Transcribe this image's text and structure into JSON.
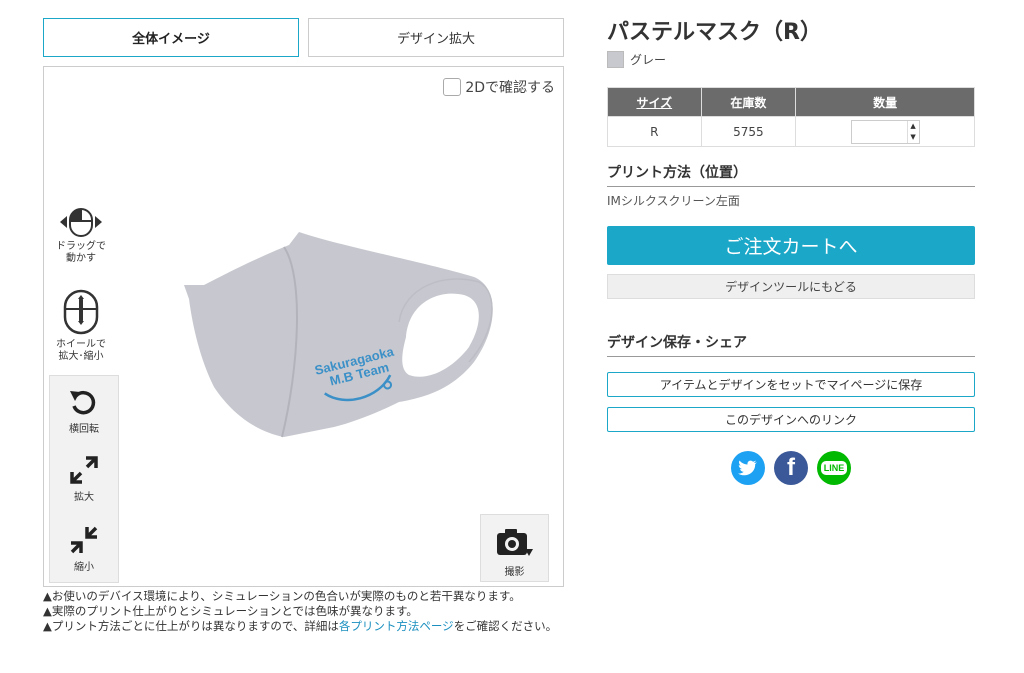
{
  "tabs": {
    "overall": "全体イメージ",
    "zoom": "デザイン拡大"
  },
  "viewer": {
    "check_2d": "2Dで確認する",
    "hint_drag": "ドラッグで\n動かす",
    "hint_wheel": "ホイールで\n拡大･縮小",
    "tool_rotate": "横回転",
    "tool_expand": "拡大",
    "tool_shrink": "縮小",
    "shoot": "撮影",
    "print_text_1": "Sakuragaoka",
    "print_text_2": "M.B Team"
  },
  "notes": {
    "n1": "お使いのデバイス環境により、シミュレーションの色合いが実際のものと若干異なります。",
    "n2": "実際のプリント仕上がりとシミュレーションとでは色味が異なります。",
    "n3_pre": "プリント方法ごとに仕上がりは異なりますので、詳細は",
    "n3_link": "各プリント方法ページ",
    "n3_post": "をご確認ください。"
  },
  "product": {
    "title": "パステルマスク（R）",
    "color_name": "グレー",
    "color_hex": "#c8c8cf"
  },
  "stock_table": {
    "headers": [
      "サイズ",
      "在庫数",
      "数量"
    ],
    "rows": [
      {
        "size": "R",
        "stock": "5755",
        "qty": ""
      }
    ]
  },
  "print_method": {
    "heading": "プリント方法（位置）",
    "value": "IMシルクスクリーン左面"
  },
  "buttons": {
    "cart": "ご注文カートへ",
    "back_to_tool": "デザインツールにもどる",
    "save_mypage": "アイテムとデザインをセットでマイページに保存",
    "design_link": "このデザインへのリンク"
  },
  "share": {
    "heading": "デザイン保存・シェア",
    "line_label": "LINE"
  },
  "colors": {
    "accent": "#1aa7c8",
    "twitter": "#1da1f2",
    "facebook": "#3b5998",
    "line": "#00b900",
    "table_header": "#6b6b6b"
  }
}
